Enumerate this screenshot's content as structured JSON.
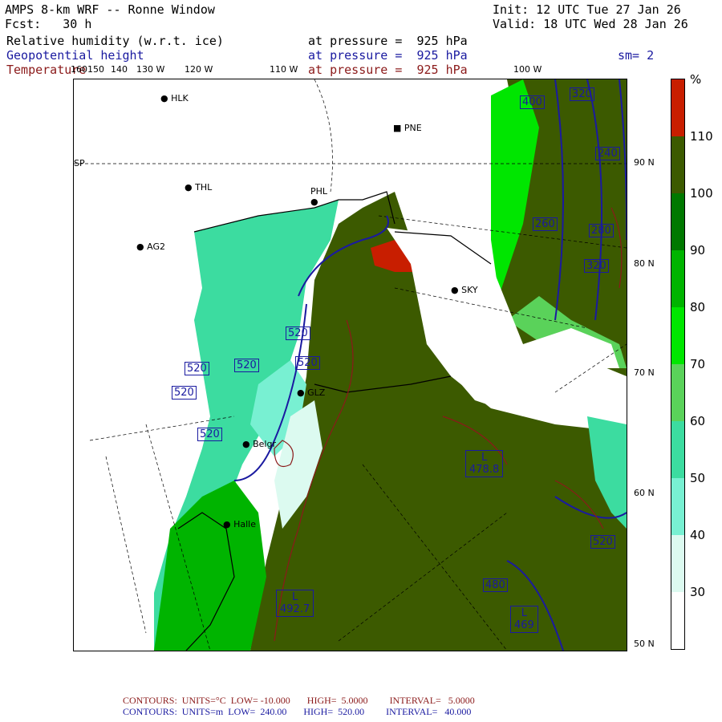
{
  "header": {
    "model": "AMPS 8-km WRF -- Ronne Window",
    "init": "Init: 12 UTC Tue 27 Jan 26",
    "fcst": "Fcst:   30 h",
    "valid": "Valid: 18 UTC Wed 28 Jan 26",
    "fields": [
      {
        "name": "Relative humidity (w.r.t. ice)",
        "level": "at pressure =  925 hPa",
        "color": "#000000"
      },
      {
        "name": "Geopotential height",
        "level": "at pressure =  925 hPa",
        "color": "#1a1aa0"
      },
      {
        "name": "Temperature",
        "level": "at pressure =  925 hPa",
        "color": "#8b1a1a"
      }
    ],
    "smoothing": "sm= 2"
  },
  "longitude_labels": [
    "160150",
    "140",
    "130 W",
    "120 W",
    "110 W",
    "100 W"
  ],
  "latitude_labels": [
    "90 N",
    "80 N",
    "70 N",
    "60 N",
    "50 N"
  ],
  "stations": [
    {
      "name": "HLK"
    },
    {
      "name": "PNE"
    },
    {
      "name": "THL"
    },
    {
      "name": "PHL"
    },
    {
      "name": "AG2"
    },
    {
      "name": "SKY"
    },
    {
      "name": "GLZ"
    },
    {
      "name": "Belgr"
    },
    {
      "name": "Halle"
    }
  ],
  "map_labels": {
    "pole": "SP",
    "height_contours": [
      "520",
      "520",
      "520",
      "520",
      "520",
      "520",
      "520",
      "480",
      "400",
      "320",
      "240",
      "280",
      "260",
      "320",
      "520"
    ],
    "lows": [
      {
        "letter": "L",
        "value": "478.8"
      },
      {
        "letter": "L",
        "value": "492.7"
      },
      {
        "letter": "L",
        "value": "469"
      }
    ]
  },
  "colorbar": {
    "unit": "%",
    "ticks": [
      "110",
      "100",
      "90",
      "80",
      "70",
      "60",
      "50",
      "40",
      "30"
    ],
    "colors": [
      "#c81e00",
      "#3c5a00",
      "#007800",
      "#00b400",
      "#00e600",
      "#5ad25a",
      "#3cdca0",
      "#78f0d2",
      "#dcfaf0",
      "#ffffff"
    ]
  },
  "footer": {
    "temp": {
      "label": "CONTOURS:",
      "units": "UNITS=°C",
      "low": "LOW= -10.000",
      "high": "HIGH=  5.0000",
      "interval": "INTERVAL=   5.0000",
      "color": "#8b1a1a"
    },
    "height": {
      "label": "CONTOURS:",
      "units": "UNITS=m",
      "low": "LOW=  240.00",
      "high": "HIGH=  520.00",
      "interval": "INTERVAL=   40.000",
      "color": "#1a1aa0"
    }
  }
}
